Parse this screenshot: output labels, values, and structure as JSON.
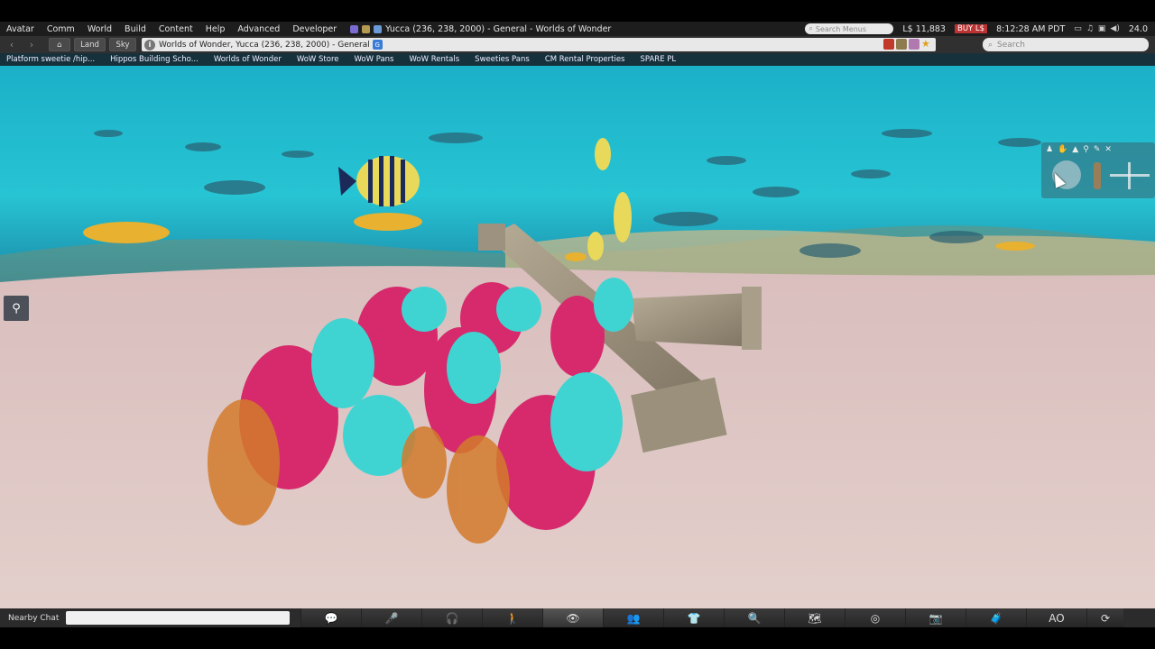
{
  "menubar": {
    "items": [
      "Avatar",
      "Comm",
      "World",
      "Build",
      "Content",
      "Help",
      "Advanced",
      "Developer"
    ],
    "window_title": "Yucca (236, 238, 2000) - General - Worlds of Wonder",
    "search_placeholder": "Search Menus",
    "balance": "L$ 11,883",
    "buy_label": "BUY L$",
    "time": "8:12:28 AM PDT",
    "fps": "24.0"
  },
  "navbar": {
    "home_icon": "home-icon",
    "land_label": "Land",
    "sky_label": "Sky",
    "location": "Worlds of Wonder, Yucca (236, 238, 2000) - General",
    "search_placeholder": "Search"
  },
  "favorites": [
    "Platform sweetie /hip...",
    "Hippos Building Scho...",
    "Worlds of Wonder",
    "WoW Store",
    "WoW Pans",
    "WoW Rentals",
    "Sweeties Pans",
    "CM Rental Properties",
    "SPARE PL"
  ],
  "bottombar": {
    "chat_label": "Nearby Chat",
    "tools": [
      {
        "icon": "speech-bubble-icon",
        "glyph": "💬"
      },
      {
        "icon": "microphone-icon",
        "glyph": "🎤"
      },
      {
        "icon": "headphones-icon",
        "glyph": "🎧"
      },
      {
        "icon": "walk-icon",
        "glyph": "🚶"
      },
      {
        "icon": "eye-icon",
        "glyph": "👁"
      },
      {
        "icon": "people-icon",
        "glyph": "👥"
      },
      {
        "icon": "shirt-icon",
        "glyph": "👕"
      },
      {
        "icon": "search-icon",
        "glyph": "🔍"
      },
      {
        "icon": "map-icon",
        "glyph": "🗺"
      },
      {
        "icon": "minimap-icon",
        "glyph": "◎"
      },
      {
        "icon": "camera-icon",
        "glyph": "📷"
      },
      {
        "icon": "inventory-icon",
        "glyph": "🧳"
      },
      {
        "icon": "ao-icon",
        "glyph": "AO"
      },
      {
        "icon": "refresh-icon",
        "glyph": "⟳"
      }
    ]
  }
}
